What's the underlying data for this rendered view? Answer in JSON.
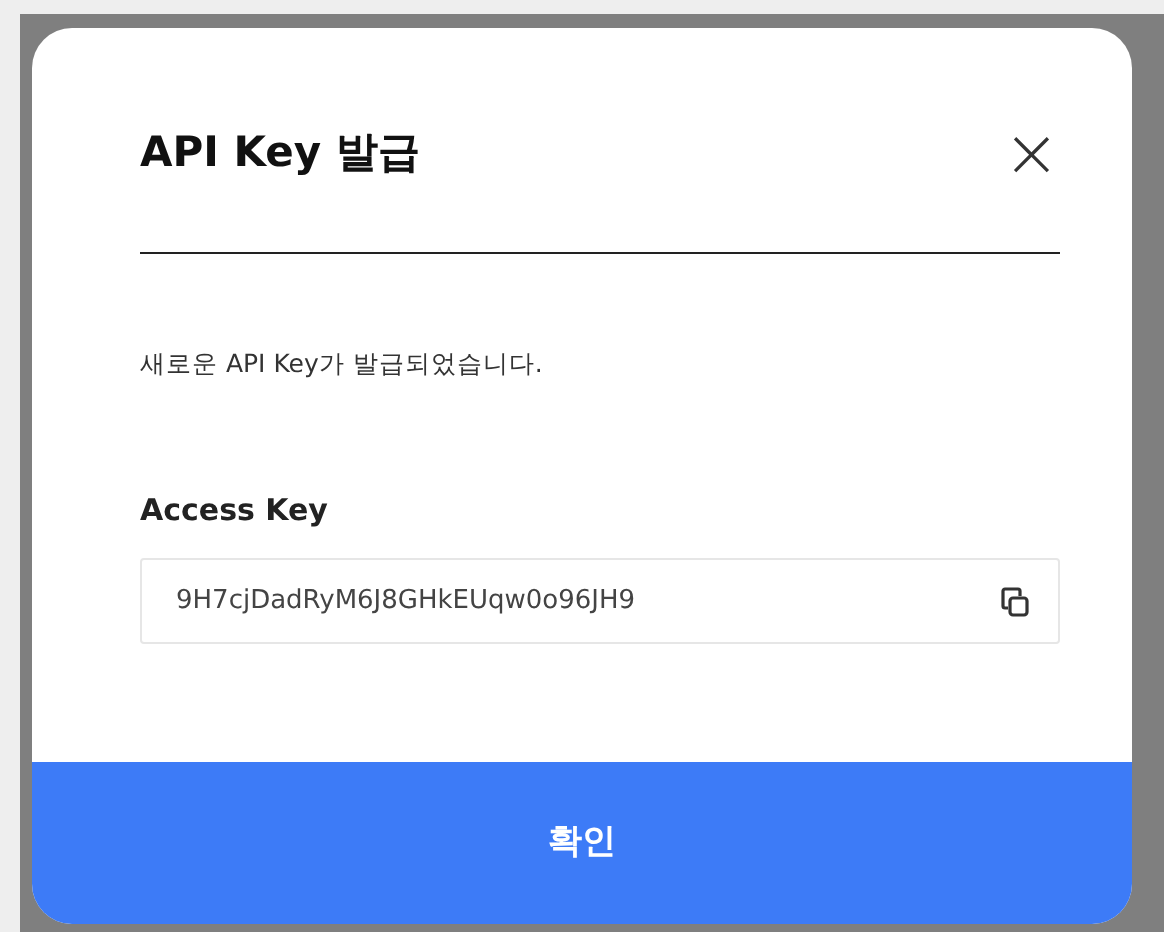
{
  "dialog": {
    "title": "API Key 발급",
    "close_symbol": "×",
    "message": "새로운 API Key가 발급되었습니다.",
    "field_label": "Access Key",
    "field_value": "9H7cjDadRyM6J8GHkEUqw0o96JH9",
    "confirm_button": "확인"
  }
}
